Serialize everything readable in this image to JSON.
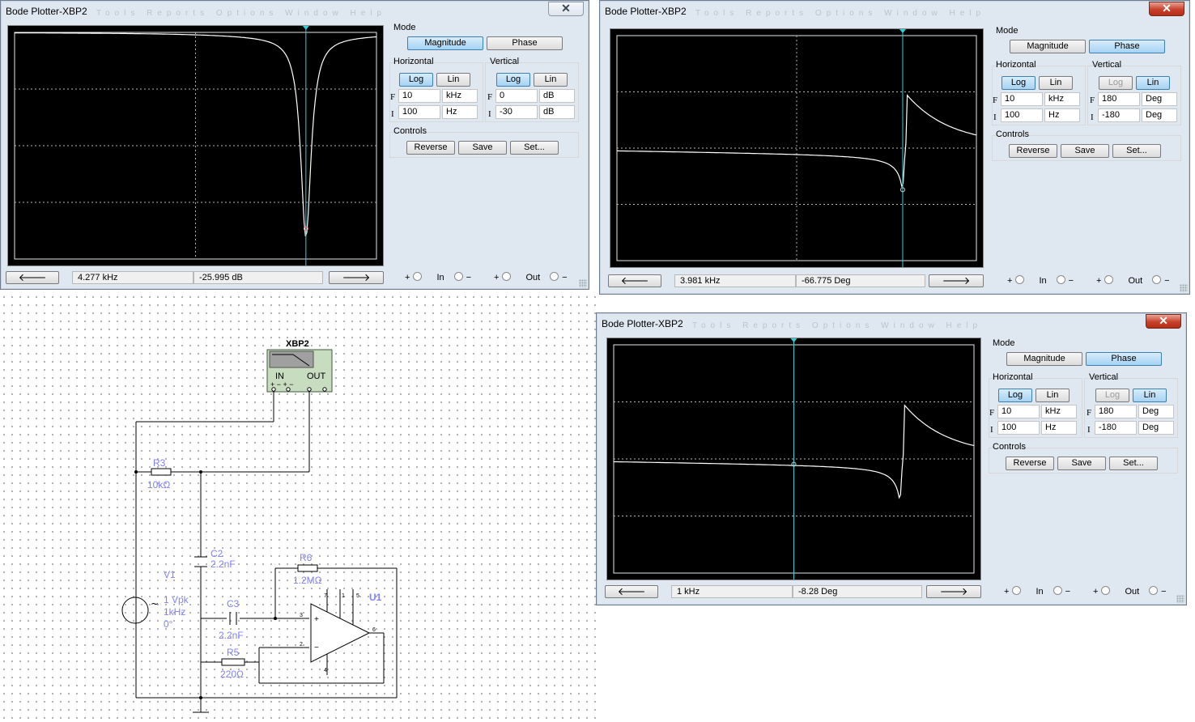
{
  "windows": [
    {
      "id": "w1",
      "title": "Bode Plotter-XBP2",
      "ghost_menu": "Tools  Reports  Options  Window  Help",
      "close_style": "plain",
      "mode": {
        "label": "Mode",
        "magnitude": "Magnitude",
        "phase": "Phase",
        "selected": "magnitude"
      },
      "horizontal": {
        "label": "Horizontal",
        "log": "Log",
        "lin": "Lin",
        "selected": "log",
        "F_value": "10",
        "F_unit": "kHz",
        "I_value": "100",
        "I_unit": "Hz"
      },
      "vertical": {
        "label": "Vertical",
        "log": "Log",
        "lin": "Lin",
        "selected": "log",
        "F_value": "0",
        "F_unit": "dB",
        "I_value": "-30",
        "I_unit": "dB"
      },
      "controls": {
        "label": "Controls",
        "reverse": "Reverse",
        "save": "Save",
        "set": "Set..."
      },
      "readout": {
        "freq": "4.277 kHz",
        "value": "-25.995 dB"
      },
      "io": {
        "plus": "+",
        "in": "In",
        "minus": "−",
        "out": "Out"
      },
      "field_letters": {
        "F": "F",
        "I": "I"
      }
    },
    {
      "id": "w2",
      "title": "Bode Plotter-XBP2",
      "ghost_menu": "Tools  Reports  Options  Window  Help",
      "close_style": "red",
      "mode": {
        "label": "Mode",
        "magnitude": "Magnitude",
        "phase": "Phase",
        "selected": "phase"
      },
      "horizontal": {
        "label": "Horizontal",
        "log": "Log",
        "lin": "Lin",
        "selected": "log",
        "F_value": "10",
        "F_unit": "kHz",
        "I_value": "100",
        "I_unit": "Hz"
      },
      "vertical": {
        "label": "Vertical",
        "log": "Log",
        "lin": "Lin",
        "selected": "lin",
        "F_value": "180",
        "F_unit": "Deg",
        "I_value": "-180",
        "I_unit": "Deg"
      },
      "controls": {
        "label": "Controls",
        "reverse": "Reverse",
        "save": "Save",
        "set": "Set..."
      },
      "readout": {
        "freq": "3.981 kHz",
        "value": "-66.775 Deg"
      },
      "io": {
        "plus": "+",
        "in": "In",
        "minus": "−",
        "out": "Out"
      },
      "field_letters": {
        "F": "F",
        "I": "I"
      }
    },
    {
      "id": "w3",
      "title": "Bode Plotter-XBP2",
      "ghost_menu": "Tools  Reports  Options  Window  Help",
      "close_style": "red",
      "mode": {
        "label": "Mode",
        "magnitude": "Magnitude",
        "phase": "Phase",
        "selected": "phase"
      },
      "horizontal": {
        "label": "Horizontal",
        "log": "Log",
        "lin": "Lin",
        "selected": "log",
        "F_value": "10",
        "F_unit": "kHz",
        "I_value": "100",
        "I_unit": "Hz"
      },
      "vertical": {
        "label": "Vertical",
        "log": "Log",
        "lin": "Lin",
        "selected": "lin",
        "F_value": "180",
        "F_unit": "Deg",
        "I_value": "-180",
        "I_unit": "Deg"
      },
      "controls": {
        "label": "Controls",
        "reverse": "Reverse",
        "save": "Save",
        "set": "Set..."
      },
      "readout": {
        "freq": "1 kHz",
        "value": "-8.28 Deg"
      },
      "io": {
        "plus": "+",
        "in": "In",
        "minus": "−",
        "out": "Out"
      },
      "field_letters": {
        "F": "F",
        "I": "I"
      }
    }
  ],
  "schematic": {
    "instrument": {
      "name": "XBP2",
      "in": "IN",
      "out": "OUT",
      "pins": "+ − + −"
    },
    "R3": {
      "ref": "R3",
      "value": "10kΩ"
    },
    "C2": {
      "ref": "C2",
      "value": "2.2nF"
    },
    "C3": {
      "ref": "C3",
      "value": "2.2nF"
    },
    "R5": {
      "ref": "R5",
      "value": "220Ω"
    },
    "R6": {
      "ref": "R6",
      "value": "1.2MΩ"
    },
    "V1": {
      "ref": "V1",
      "line1": "1 Vpk",
      "line2": "1kHz",
      "line3": "0°"
    },
    "U1": {
      "ref": "U1",
      "pins": [
        "7",
        "1",
        "5",
        "3",
        "2",
        "6",
        "4"
      ]
    }
  },
  "colors": {
    "schematic_label": "#8080ff",
    "trace": "#ffffff",
    "cursor": "#35d0d6",
    "grid": "#b4b4b4"
  }
}
